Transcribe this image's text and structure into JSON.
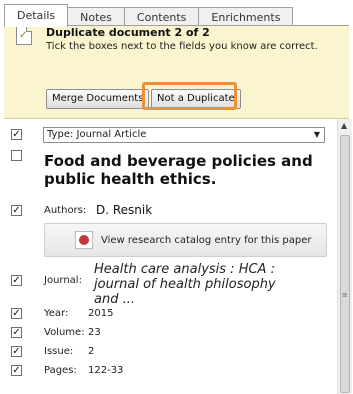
{
  "tabs": [
    "Details",
    "Notes",
    "Contents",
    "Enrichments"
  ],
  "notice": {
    "title": "Duplicate document 2 of 2",
    "description": "Tick the boxes next to the fields you know are correct.",
    "merge_label": "Merge Documents",
    "not_duplicate_label": "Not a Duplicate"
  },
  "fields": {
    "type_label": "Type:",
    "type_value": "Journal Article",
    "title": "Food and beverage policies and public health ethics.",
    "authors_label": "Authors:",
    "authors_value": "D. Resnik",
    "research_link": "View research catalog entry for this paper",
    "journal_label": "Journal:",
    "journal_value": "Health care analysis : HCA : journal of health philosophy and ...",
    "year_label": "Year:",
    "year_value": "2015",
    "volume_label": "Volume:",
    "volume_value": "23",
    "issue_label": "Issue:",
    "issue_value": "2",
    "pages_label": "Pages:",
    "pages_value": "122-33"
  },
  "checkboxes": {
    "type": true,
    "title": false,
    "authors": true,
    "journal": true,
    "year": true,
    "volume": true,
    "issue": true,
    "pages": true
  },
  "icons": [
    "document-check-icon",
    "research-catalog-icon",
    "dropdown-arrow-icon",
    "scroll-up-icon",
    "scroll-grip-icon"
  ]
}
